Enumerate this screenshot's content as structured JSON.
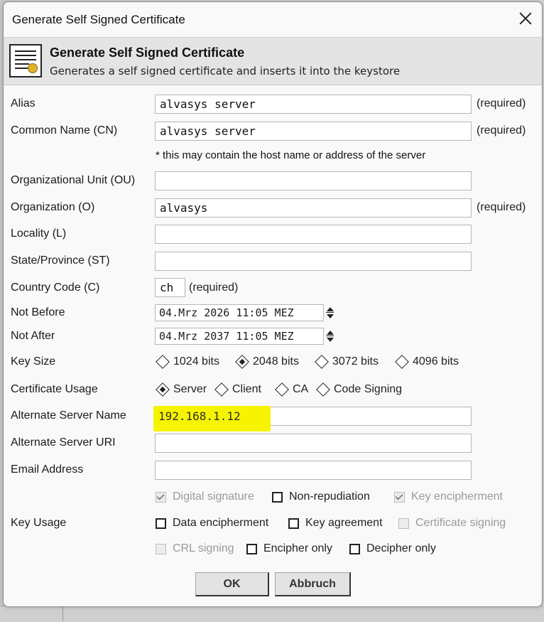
{
  "window": {
    "title": "Generate Self Signed Certificate"
  },
  "header": {
    "title": "Generate Self Signed Certificate",
    "description": "Generates a self signed certificate and inserts it into the keystore",
    "icon": "certificate-icon"
  },
  "fields": {
    "alias": {
      "label": "Alias",
      "value": "alvasys server",
      "note": "(required)"
    },
    "common_name": {
      "label": "Common Name (CN)",
      "value": "alvasys server",
      "note": "(required)",
      "hint": "* this may contain the host name or address of the server"
    },
    "org_unit": {
      "label": "Organizational Unit (OU)",
      "value": ""
    },
    "organization": {
      "label": "Organization (O)",
      "value": "alvasys",
      "note": "(required)"
    },
    "locality": {
      "label": "Locality (L)",
      "value": ""
    },
    "state": {
      "label": "State/Province (ST)",
      "value": ""
    },
    "country": {
      "label": "Country Code (C)",
      "value": "ch",
      "note": "(required)"
    },
    "not_before": {
      "label": "Not Before",
      "value": "04.Mrz 2026 11:05 MEZ"
    },
    "not_after": {
      "label": "Not After",
      "value": "04.Mrz 2037 11:05 MEZ"
    },
    "alt_server_name": {
      "label": "Alternate Server Name",
      "value": "192.168.1.12",
      "highlight_color": "#ffff00"
    },
    "alt_server_uri": {
      "label": "Alternate Server URI",
      "value": ""
    },
    "email": {
      "label": "Email Address",
      "value": ""
    }
  },
  "key_size": {
    "label": "Key Size",
    "options": [
      "1024 bits",
      "2048 bits",
      "3072 bits",
      "4096 bits"
    ],
    "selected": "2048 bits"
  },
  "cert_usage": {
    "label": "Certificate Usage",
    "options": [
      "Server",
      "Client",
      "CA",
      "Code Signing"
    ],
    "selected": "Server"
  },
  "key_usage": {
    "label": "Key Usage",
    "items": [
      {
        "label": "Digital signature",
        "checked": true,
        "enabled": false
      },
      {
        "label": "Non-repudiation",
        "checked": false,
        "enabled": true
      },
      {
        "label": "Key encipherment",
        "checked": true,
        "enabled": false
      },
      {
        "label": "Data encipherment",
        "checked": false,
        "enabled": true
      },
      {
        "label": "Key agreement",
        "checked": false,
        "enabled": true
      },
      {
        "label": "Certificate signing",
        "checked": false,
        "enabled": false
      },
      {
        "label": "CRL signing",
        "checked": false,
        "enabled": false
      },
      {
        "label": "Encipher only",
        "checked": false,
        "enabled": true
      },
      {
        "label": "Decipher only",
        "checked": false,
        "enabled": true
      }
    ]
  },
  "buttons": {
    "ok": "OK",
    "cancel": "Abbruch"
  }
}
